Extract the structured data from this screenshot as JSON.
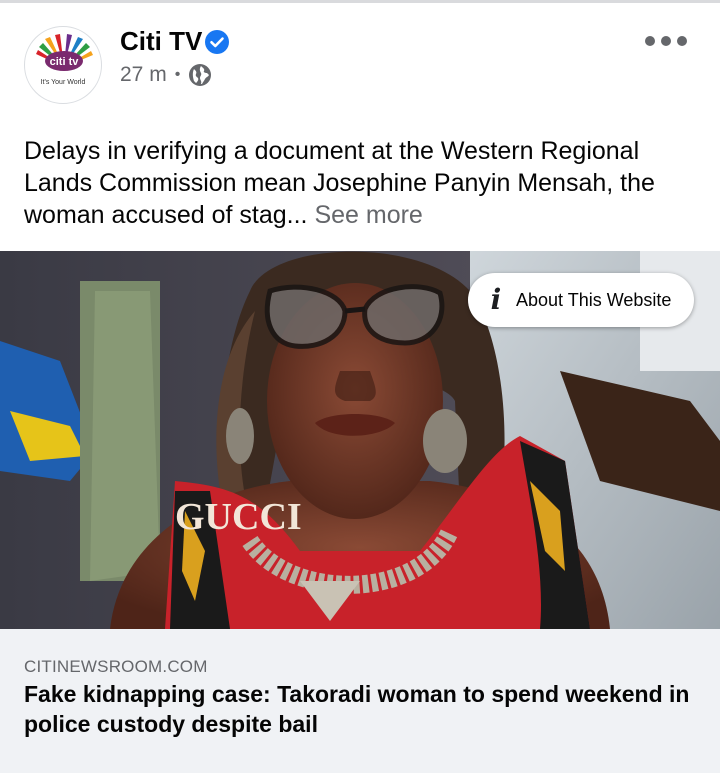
{
  "post": {
    "page_name": "Citi TV",
    "verified": true,
    "time": "27 m",
    "separator": "•",
    "privacy_icon": "globe-icon",
    "more_icon": "more-horizontal-icon",
    "avatar": {
      "logo_text": "citi tv",
      "tagline": "It's Your World"
    },
    "caption": {
      "text": "Delays in verifying a document at the Western Regional Lands Commission mean Josephine Panyin Mensah, the woman accused of stag...",
      "see_more": "See more"
    },
    "image": {
      "about_label": "About This Website",
      "about_icon": "info-icon",
      "shirt_text": "GUCCI"
    },
    "link": {
      "domain": "CITINEWSROOM.COM",
      "headline": "Fake kidnapping case: Takoradi woman to spend weekend in police custody despite bail"
    }
  },
  "colors": {
    "verified_blue": "#1877f2",
    "secondary_text": "#65676b",
    "link_background": "#f0f2f5",
    "logo_red": "#d8232a",
    "logo_green": "#2e9e44",
    "logo_orange": "#f5a21c",
    "logo_purple": "#6b2d8c"
  }
}
